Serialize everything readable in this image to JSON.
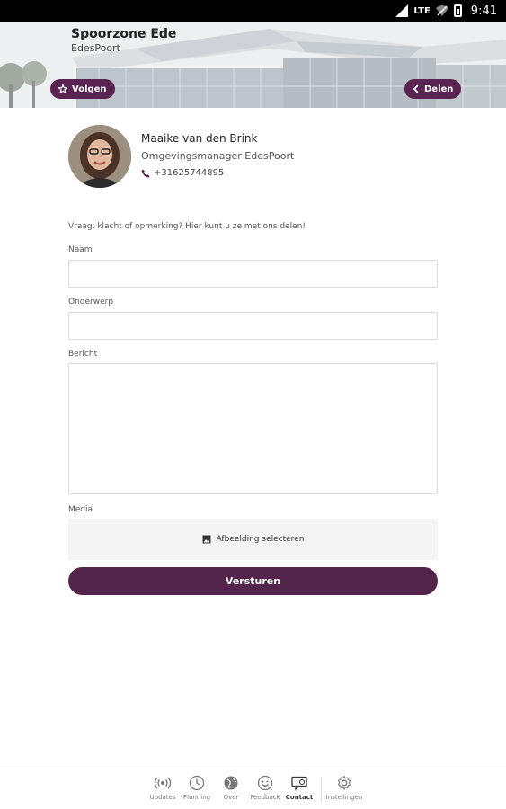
{
  "status_bar": {
    "network": "LTE",
    "time": "9:41"
  },
  "header": {
    "title": "Spoorzone Ede",
    "subtitle": "EdesPoort",
    "follow_label": "Volgen",
    "share_label": "Delen"
  },
  "contact": {
    "name": "Maaike van den Brink",
    "role": "Omgevingsmanager EdesPoort",
    "phone": "+31625744895"
  },
  "form": {
    "intro": "Vraag, klacht of opmerking? Hier kunt u ze met ons delen!",
    "name_label": "Naam",
    "name_value": "",
    "subject_label": "Onderwerp",
    "subject_value": "",
    "message_label": "Bericht",
    "message_value": "",
    "media_label": "Media",
    "select_image_label": "Afbeelding selecteren",
    "submit_label": "Versturen"
  },
  "bottom_nav": {
    "items": [
      {
        "label": "Updates",
        "icon": "broadcast-icon"
      },
      {
        "label": "Planning",
        "icon": "clock-icon"
      },
      {
        "label": "Over",
        "icon": "globe-icon"
      },
      {
        "label": "Feedback",
        "icon": "smiley-icon"
      },
      {
        "label": "Contact",
        "icon": "contact-card-icon",
        "active": true
      },
      {
        "label": "Instellingen",
        "icon": "gear-icon"
      }
    ]
  },
  "colors": {
    "brand": "#53254c",
    "statusbar": "#000000"
  }
}
